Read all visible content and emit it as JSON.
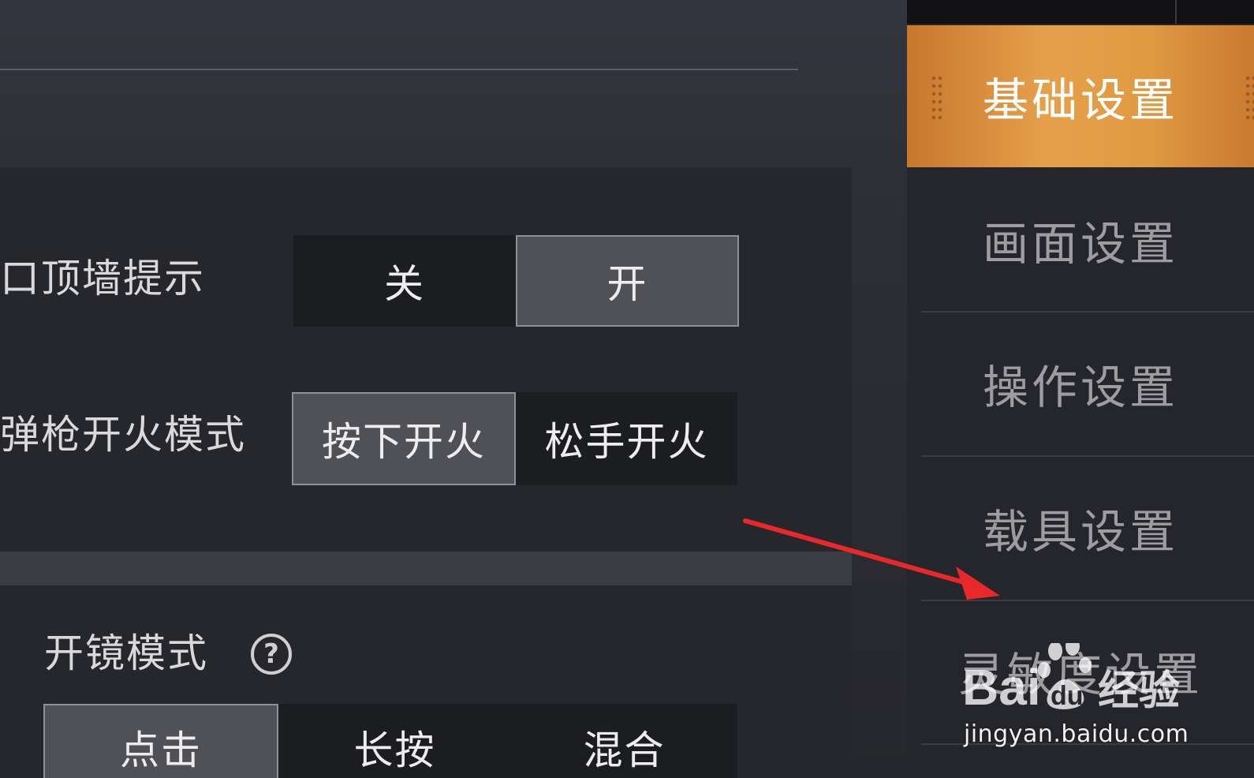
{
  "settings": {
    "row1": {
      "label": "口顶墙提示",
      "options": [
        "关",
        "开"
      ],
      "selected": "开"
    },
    "row2": {
      "label": "弹枪开火模式",
      "options": [
        "按下开火",
        "松手开火"
      ],
      "selected": "按下开火"
    },
    "row3": {
      "label": "开镜模式",
      "help_icon": "?",
      "options": [
        "点击",
        "长按",
        "混合"
      ],
      "selected": "点击"
    }
  },
  "sidebar": {
    "items": [
      {
        "label": "基础设置",
        "active": true
      },
      {
        "label": "画面设置",
        "active": false
      },
      {
        "label": "操作设置",
        "active": false
      },
      {
        "label": "载具设置",
        "active": false
      },
      {
        "label": "灵敏度设置",
        "active": false
      }
    ]
  },
  "annotation": {
    "arrow_color": "#e8282a"
  },
  "watermark": {
    "logo": "Bai du 经验",
    "url": "jingyan.baidu.com"
  },
  "colors": {
    "active_tab": "#e09a42",
    "selected_option": "#505157"
  }
}
